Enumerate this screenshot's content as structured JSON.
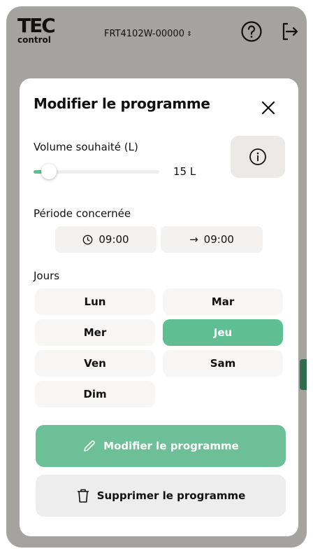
{
  "header": {
    "logo_top": "TEC",
    "logo_bottom": "control",
    "device_name": "FRT4102W-00000",
    "icons": [
      "chevron-updown-icon",
      "help-icon",
      "logout-icon"
    ]
  },
  "modal": {
    "title": "Modifier le programme",
    "volume": {
      "label": "Volume souhaité (L)",
      "value_text": "15 L",
      "slider_fraction": 0.12
    },
    "period": {
      "label": "Période concernée",
      "start": "09:00",
      "end": "09:00"
    },
    "days": {
      "label": "Jours",
      "items": [
        {
          "label": "Lun",
          "selected": false
        },
        {
          "label": "Mar",
          "selected": false
        },
        {
          "label": "Mer",
          "selected": false
        },
        {
          "label": "Jeu",
          "selected": true
        },
        {
          "label": "Ven",
          "selected": false
        },
        {
          "label": "Sam",
          "selected": false
        },
        {
          "label": "Dim",
          "selected": false
        }
      ]
    },
    "buttons": {
      "modify": "Modifier le programme",
      "delete": "Supprimer le programme"
    }
  },
  "colors": {
    "accent": "#5fbf92",
    "overlay": "#a5a3a0",
    "edge_tab": "#2f6d4e"
  }
}
